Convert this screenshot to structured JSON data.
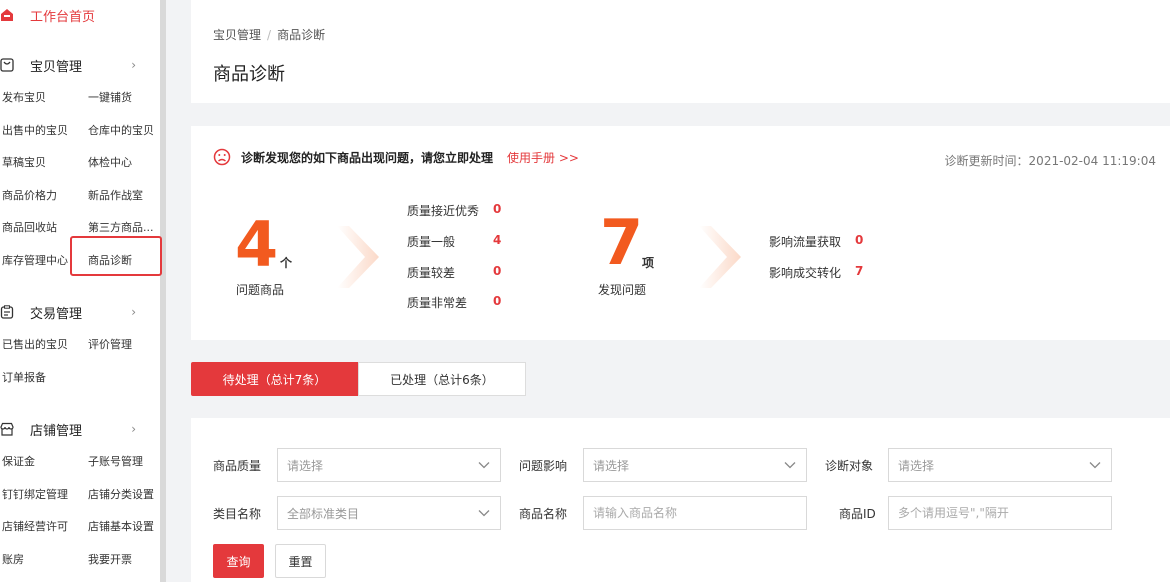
{
  "sidebar": {
    "home": "工作台首页",
    "sections": [
      {
        "title": "宝贝管理",
        "items": [
          "发布宝贝",
          "一键铺货",
          "出售中的宝贝",
          "仓库中的宝贝",
          "草稿宝贝",
          "体检中心",
          "商品价格力",
          "新品作战室",
          "商品回收站",
          "第三方商品...",
          "库存管理中心",
          "商品诊断"
        ]
      },
      {
        "title": "交易管理",
        "items": [
          "已售出的宝贝",
          "评价管理",
          "订单报备"
        ]
      },
      {
        "title": "店铺管理",
        "items": [
          "保证金",
          "子账号管理",
          "钉钉绑定管理",
          "店铺分类设置",
          "店铺经营许可",
          "店铺基本设置",
          "账房",
          "我要开票"
        ]
      }
    ],
    "chevron": "›"
  },
  "header": {
    "breadcrumb": [
      "宝贝管理",
      "商品诊断"
    ],
    "separator": "/",
    "title": "商品诊断"
  },
  "diagnosis": {
    "alert": "诊断发现您的如下商品出现问题，请您立即处理",
    "manual_link": "使用手册 >>",
    "update_time": "诊断更新时间：2021-02-04 11:19:04",
    "problem_goods": {
      "count": "4",
      "unit": "个",
      "label": "问题商品"
    },
    "quality": [
      {
        "label": "质量接近优秀",
        "value": "0"
      },
      {
        "label": "质量一般",
        "value": "4"
      },
      {
        "label": "质量较差",
        "value": "0"
      },
      {
        "label": "质量非常差",
        "value": "0"
      }
    ],
    "found_issues": {
      "count": "7",
      "unit": "项",
      "label": "发现问题"
    },
    "impact": [
      {
        "label": "影响流量获取",
        "value": "0"
      },
      {
        "label": "影响成交转化",
        "value": "7"
      }
    ]
  },
  "tabs": [
    {
      "label": "待处理（总计7条）",
      "active": true
    },
    {
      "label": "已处理（总计6条）",
      "active": false
    }
  ],
  "filters": {
    "quality_label": "商品质量",
    "quality_placeholder": "请选择",
    "impact_label": "问题影响",
    "impact_placeholder": "请选择",
    "target_label": "诊断对象",
    "target_placeholder": "请选择",
    "category_label": "类目名称",
    "category_value": "全部标准类目",
    "name_label": "商品名称",
    "name_placeholder": "请输入商品名称",
    "id_label": "商品ID",
    "id_placeholder": "多个请用逗号\",\"隔开"
  },
  "buttons": {
    "query": "查询",
    "reset": "重置"
  },
  "colors": {
    "accent": "#e4393c",
    "number": "#f25a1f"
  }
}
